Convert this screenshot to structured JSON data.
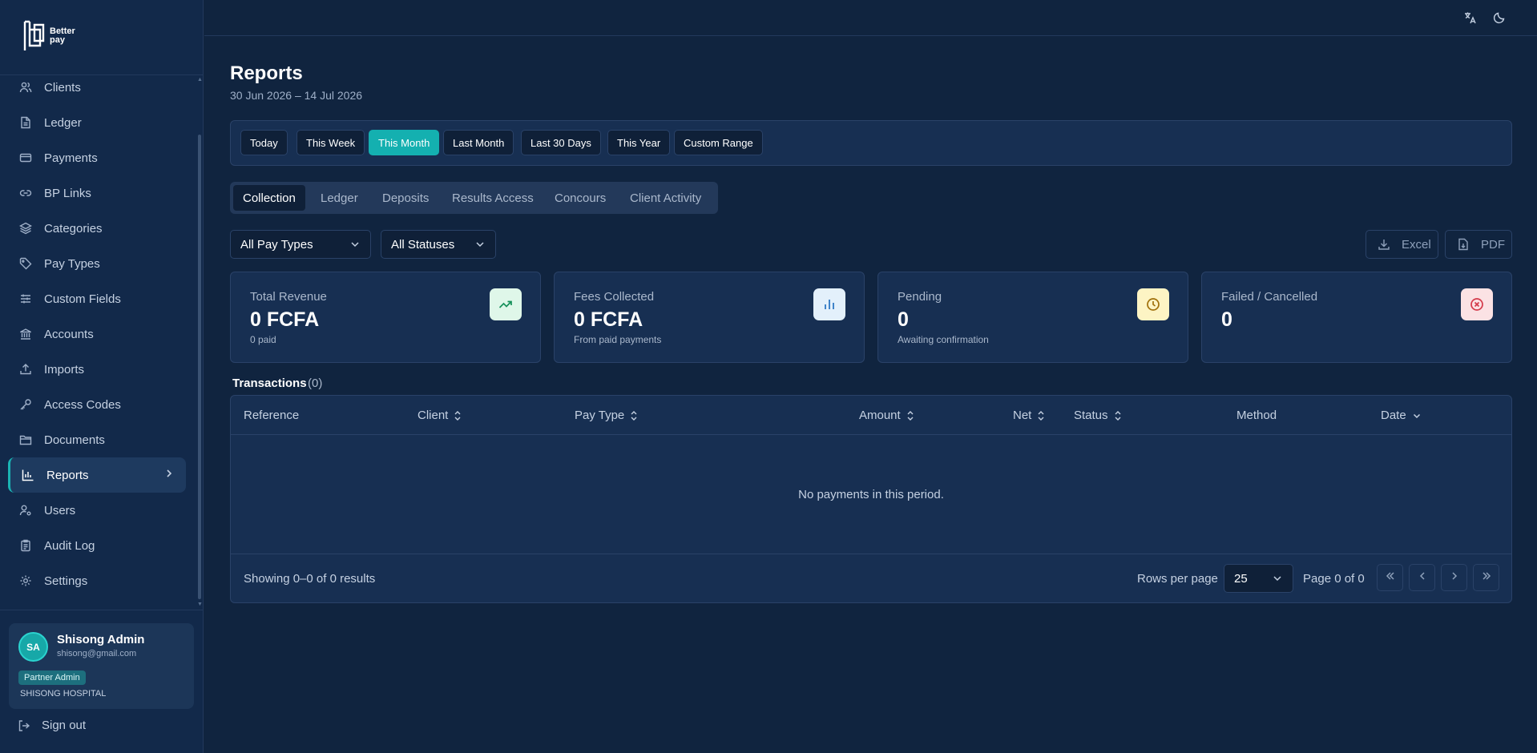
{
  "brand": {
    "name_line1": "Better",
    "name_line2": "pay"
  },
  "sidebar": {
    "items": [
      {
        "label": "Clients",
        "icon": "users-icon"
      },
      {
        "label": "Ledger",
        "icon": "file-text-icon"
      },
      {
        "label": "Payments",
        "icon": "credit-card-icon"
      },
      {
        "label": "BP Links",
        "icon": "link-icon"
      },
      {
        "label": "Categories",
        "icon": "layers-icon"
      },
      {
        "label": "Pay Types",
        "icon": "tag-icon"
      },
      {
        "label": "Custom Fields",
        "icon": "sliders-icon"
      },
      {
        "label": "Accounts",
        "icon": "bank-icon"
      },
      {
        "label": "Imports",
        "icon": "upload-icon"
      },
      {
        "label": "Access Codes",
        "icon": "key-icon"
      },
      {
        "label": "Documents",
        "icon": "folder-icon"
      },
      {
        "label": "Reports",
        "icon": "bar-chart-icon",
        "active": true
      },
      {
        "label": "Users",
        "icon": "user-cog-icon"
      },
      {
        "label": "Audit Log",
        "icon": "clipboard-icon"
      },
      {
        "label": "Settings",
        "icon": "gear-icon"
      }
    ]
  },
  "user": {
    "initials": "SA",
    "name": "Shisong Admin",
    "email": "shisong@gmail.com",
    "role": "Partner Admin",
    "org": "SHISONG HOSPITAL"
  },
  "signout_label": "Sign out",
  "page": {
    "title": "Reports",
    "range": "30 Jun 2026 – 14 Jul 2026"
  },
  "ranges": [
    "Today",
    "This Week",
    "This Month",
    "Last Month",
    "Last 30 Days",
    "This Year",
    "Custom Range"
  ],
  "active_range": "This Month",
  "tabs": [
    "Collection",
    "Ledger",
    "Deposits",
    "Results Access",
    "Concours",
    "Client Activity"
  ],
  "active_tab": "Collection",
  "filters": {
    "pay_type": "All Pay Types",
    "status": "All Statuses"
  },
  "export": {
    "excel": "Excel",
    "pdf": "PDF"
  },
  "stats": [
    {
      "label": "Total Revenue",
      "value": "0 FCFA",
      "sub": "0 paid",
      "icon": "trending-up-icon",
      "color": "#dff7e9"
    },
    {
      "label": "Fees Collected",
      "value": "0 FCFA",
      "sub": "From paid payments",
      "icon": "bar-chart-icon",
      "color": "#e3f0fb"
    },
    {
      "label": "Pending",
      "value": "0",
      "sub": "Awaiting confirmation",
      "icon": "clock-icon",
      "color": "#fdf4c4"
    },
    {
      "label": "Failed / Cancelled",
      "value": "0",
      "sub": "",
      "icon": "x-circle-icon",
      "color": "#fbe2e4"
    }
  ],
  "transactions": {
    "title": "Transactions",
    "count": "(0)",
    "columns": [
      "Reference",
      "Client",
      "Pay Type",
      "Amount",
      "Net",
      "Status",
      "Method",
      "Date"
    ],
    "empty": "No payments in this period.",
    "showing": "Showing 0–0 of 0 results",
    "rows_per_page_label": "Rows per page",
    "rows_per_page": "25",
    "page_info": "Page 0 of 0"
  },
  "colors": {
    "accent": "#14b0b0",
    "background": "#10243f",
    "sidebar": "#12294a"
  }
}
